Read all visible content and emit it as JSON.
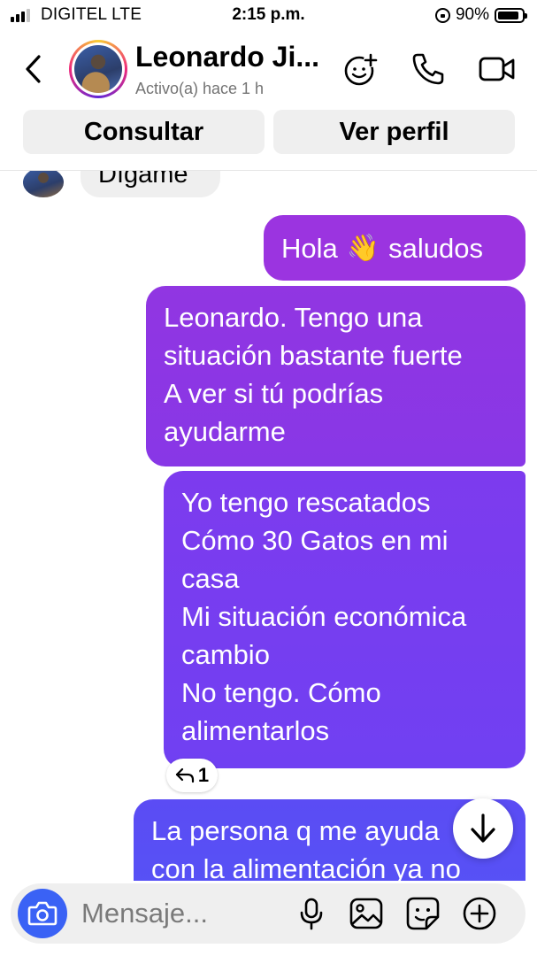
{
  "status_bar": {
    "carrier": "DIGITEL   LTE",
    "time": "2:15 p.m.",
    "battery": "90%",
    "battery_level": 0.9,
    "signal_bars_filled": 3,
    "signal_bars_total": 4
  },
  "header": {
    "contact_name": "Leonardo Ji...",
    "contact_status": "Activo(a) hace 1 h",
    "icons": [
      "back-icon",
      "add-effect-icon",
      "phone-icon",
      "video-icon"
    ]
  },
  "actions": {
    "consult_label": "Consultar",
    "profile_label": "Ver perfil"
  },
  "messages": {
    "incoming_partial": "Dígame",
    "m1_text_a": "Hola",
    "m1_emoji": "👋",
    "m1_text_b": "saludos",
    "m2_lines": [
      "Leonardo. Tengo una",
      "situación bastante fuerte",
      "A ver si tú podrías",
      "ayudarme"
    ],
    "m3_lines": [
      "Yo tengo rescatados",
      "Cómo 30 Gatos en mi",
      "casa",
      "Mi situación económica",
      "cambio",
      "No tengo. Cómo",
      "alimentarlos"
    ],
    "m3_reply_count": "1",
    "m4_lines": [
      "La persona q me ayuda",
      "con la alimentación ya no"
    ]
  },
  "composer": {
    "placeholder": "Mensaje...",
    "icons": [
      "camera-icon",
      "microphone-icon",
      "gallery-icon",
      "sticker-icon",
      "plus-icon"
    ]
  },
  "colors": {
    "camera_button": "#3a62f5",
    "bubble_top": "#9b34e0",
    "bubble_bottom": "#5553f6",
    "incoming_bubble": "#efefef"
  }
}
